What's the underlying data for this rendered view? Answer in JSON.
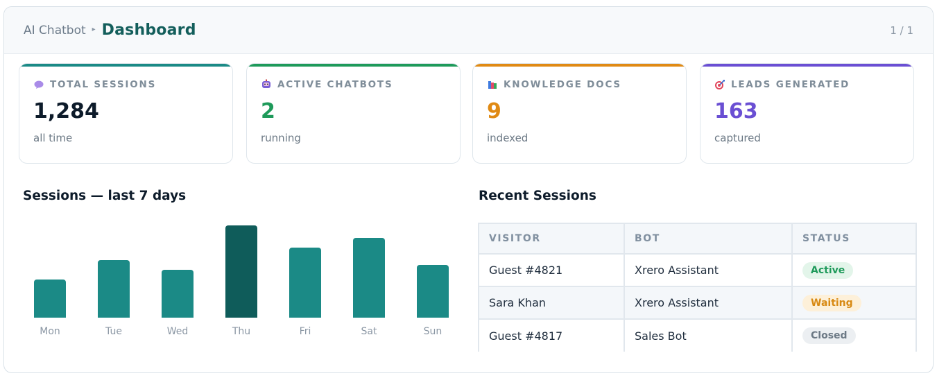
{
  "header": {
    "breadcrumb_root": "AI Chatbot",
    "breadcrumb_separator": "▸",
    "title": "Dashboard",
    "pager": "1 / 1"
  },
  "stats": [
    {
      "label": "TOTAL SESSIONS",
      "value": "1,284",
      "sub": "all time",
      "icon": "speech-bubble-icon",
      "accent": "#1b8a86",
      "value_color": "#0d1b2a"
    },
    {
      "label": "ACTIVE CHATBOTS",
      "value": "2",
      "sub": "running",
      "icon": "robot-icon",
      "accent": "#1e9a5a",
      "value_color": "#1e9a5a"
    },
    {
      "label": "KNOWLEDGE DOCS",
      "value": "9",
      "sub": "indexed",
      "icon": "books-icon",
      "accent": "#e08a14",
      "value_color": "#e08a14"
    },
    {
      "label": "LEADS GENERATED",
      "value": "163",
      "sub": "captured",
      "icon": "target-icon",
      "accent": "#6a4fd3",
      "value_color": "#6a4fd3"
    }
  ],
  "chart_section": {
    "title": "Sessions — last 7 days"
  },
  "chart_data": {
    "type": "bar",
    "categories": [
      "Mon",
      "Tue",
      "Wed",
      "Thu",
      "Fri",
      "Sat",
      "Sun"
    ],
    "values": [
      48,
      72,
      60,
      116,
      88,
      100,
      66
    ],
    "highlight": "Thu",
    "colors": {
      "bar": "#1b8a86",
      "highlight": "#0f5c5a"
    },
    "ylim": [
      0,
      120
    ],
    "grid": false
  },
  "sessions_section": {
    "title": "Recent Sessions",
    "columns": [
      "VISITOR",
      "BOT",
      "STATUS"
    ],
    "rows": [
      {
        "visitor": "Guest #4821",
        "bot": "Xrero Assistant",
        "status": "Active",
        "status_bg": "#e3f5ea",
        "status_fg": "#1e9a5a"
      },
      {
        "visitor": "Sara Khan",
        "bot": "Xrero Assistant",
        "status": "Waiting",
        "status_bg": "#fdf0d9",
        "status_fg": "#d88a14"
      },
      {
        "visitor": "Guest #4817",
        "bot": "Sales Bot",
        "status": "Closed",
        "status_bg": "#eceff2",
        "status_fg": "#6c7985"
      }
    ]
  }
}
